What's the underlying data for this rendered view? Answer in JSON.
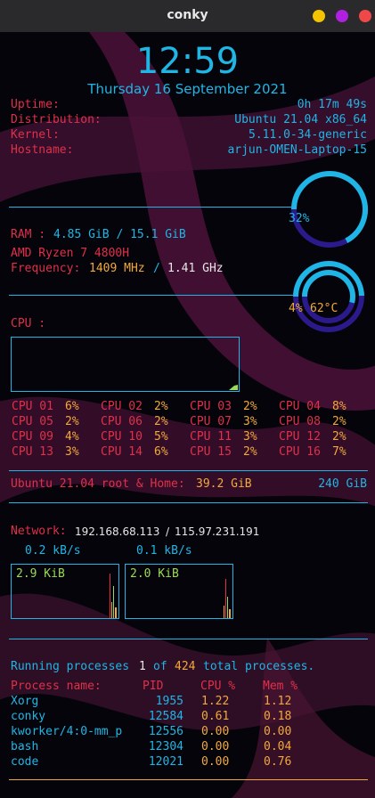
{
  "window": {
    "title": "conky",
    "buttons": [
      "minimize",
      "maximize",
      "close"
    ]
  },
  "clock": {
    "time": "12:59",
    "date": "Thursday 16 September 2021"
  },
  "info": [
    {
      "label": "Uptime:",
      "value": "0h 17m 49s"
    },
    {
      "label": "Distribution:",
      "value": "Ubuntu 21.04 x86_64"
    },
    {
      "label": "Kernel:",
      "value": "5.11.0-34-generic"
    },
    {
      "label": "Hostname:",
      "value": "arjun-OMEN-Laptop-15"
    }
  ],
  "ram": {
    "percent": "32%",
    "percent_value": 0.32,
    "label": "RAM :",
    "used": "4.85 GiB / 15.1 GiB"
  },
  "cpu_info": {
    "model": "AMD Ryzen 7 4800H",
    "freq_label": "Frequency:",
    "freq_mhz": "1409 MHz",
    "separator": "/",
    "freq_ghz": "1.41 GHz",
    "usage": "4%",
    "temp": "62°C",
    "usage_value": 0.04,
    "temp_value": 0.62
  },
  "cpu_graph": {
    "label": "CPU :"
  },
  "cores": [
    {
      "name": "CPU 01",
      "val": "6%"
    },
    {
      "name": "CPU 02",
      "val": "2%"
    },
    {
      "name": "CPU 03",
      "val": "2%"
    },
    {
      "name": "CPU 04",
      "val": "8%"
    },
    {
      "name": "CPU 05",
      "val": "2%"
    },
    {
      "name": "CPU 06",
      "val": "2%"
    },
    {
      "name": "CPU 07",
      "val": "3%"
    },
    {
      "name": "CPU 08",
      "val": "2%"
    },
    {
      "name": "CPU 09",
      "val": "4%"
    },
    {
      "name": "CPU 10",
      "val": "5%"
    },
    {
      "name": "CPU 11",
      "val": "3%"
    },
    {
      "name": "CPU 12",
      "val": "2%"
    },
    {
      "name": "CPU 13",
      "val": "3%"
    },
    {
      "name": "CPU 14",
      "val": "6%"
    },
    {
      "name": "CPU 15",
      "val": "2%"
    },
    {
      "name": "CPU 16",
      "val": "7%"
    }
  ],
  "disk": {
    "label": "Ubuntu 21.04 root & Home:",
    "used": "39.2 GiB",
    "total": "240 GiB"
  },
  "network": {
    "label": "Network:",
    "local_ip": "192.168.68.113",
    "separator": "/",
    "public_ip": "115.97.231.191",
    "down_speed": "0.2 kB/s",
    "up_speed": "0.1 kB/s",
    "down_total": "2.9 KiB",
    "up_total": "2.0 KiB"
  },
  "processes": {
    "prefix": "Running processes",
    "running": "1",
    "of": "of",
    "total": "424",
    "suffix": "total processes.",
    "headers": {
      "name": "Process name:",
      "pid": "PID",
      "cpu": "CPU %",
      "mem": "Mem %"
    },
    "rows": [
      {
        "name": "Xorg",
        "pid": "1955",
        "cpu": "1.22",
        "mem": "1.12"
      },
      {
        "name": "conky",
        "pid": "12584",
        "cpu": "0.61",
        "mem": "0.18"
      },
      {
        "name": "kworker/4:0-mm_p",
        "pid": "12556",
        "cpu": "0.00",
        "mem": "0.00"
      },
      {
        "name": "bash",
        "pid": "12304",
        "cpu": "0.00",
        "mem": "0.04"
      },
      {
        "name": "code",
        "pid": "12021",
        "cpu": "0.00",
        "mem": "0.76"
      }
    ]
  },
  "colors": {
    "label_red": "#e0304a",
    "accent_cyan": "#1fb6e6",
    "value_orange": "#f2a93b",
    "graph_green": "#9bd95a",
    "ring_dark": "#2a1a8c",
    "btn_min": "#f5c400",
    "btn_max": "#b020e0",
    "btn_close": "#f04848"
  }
}
